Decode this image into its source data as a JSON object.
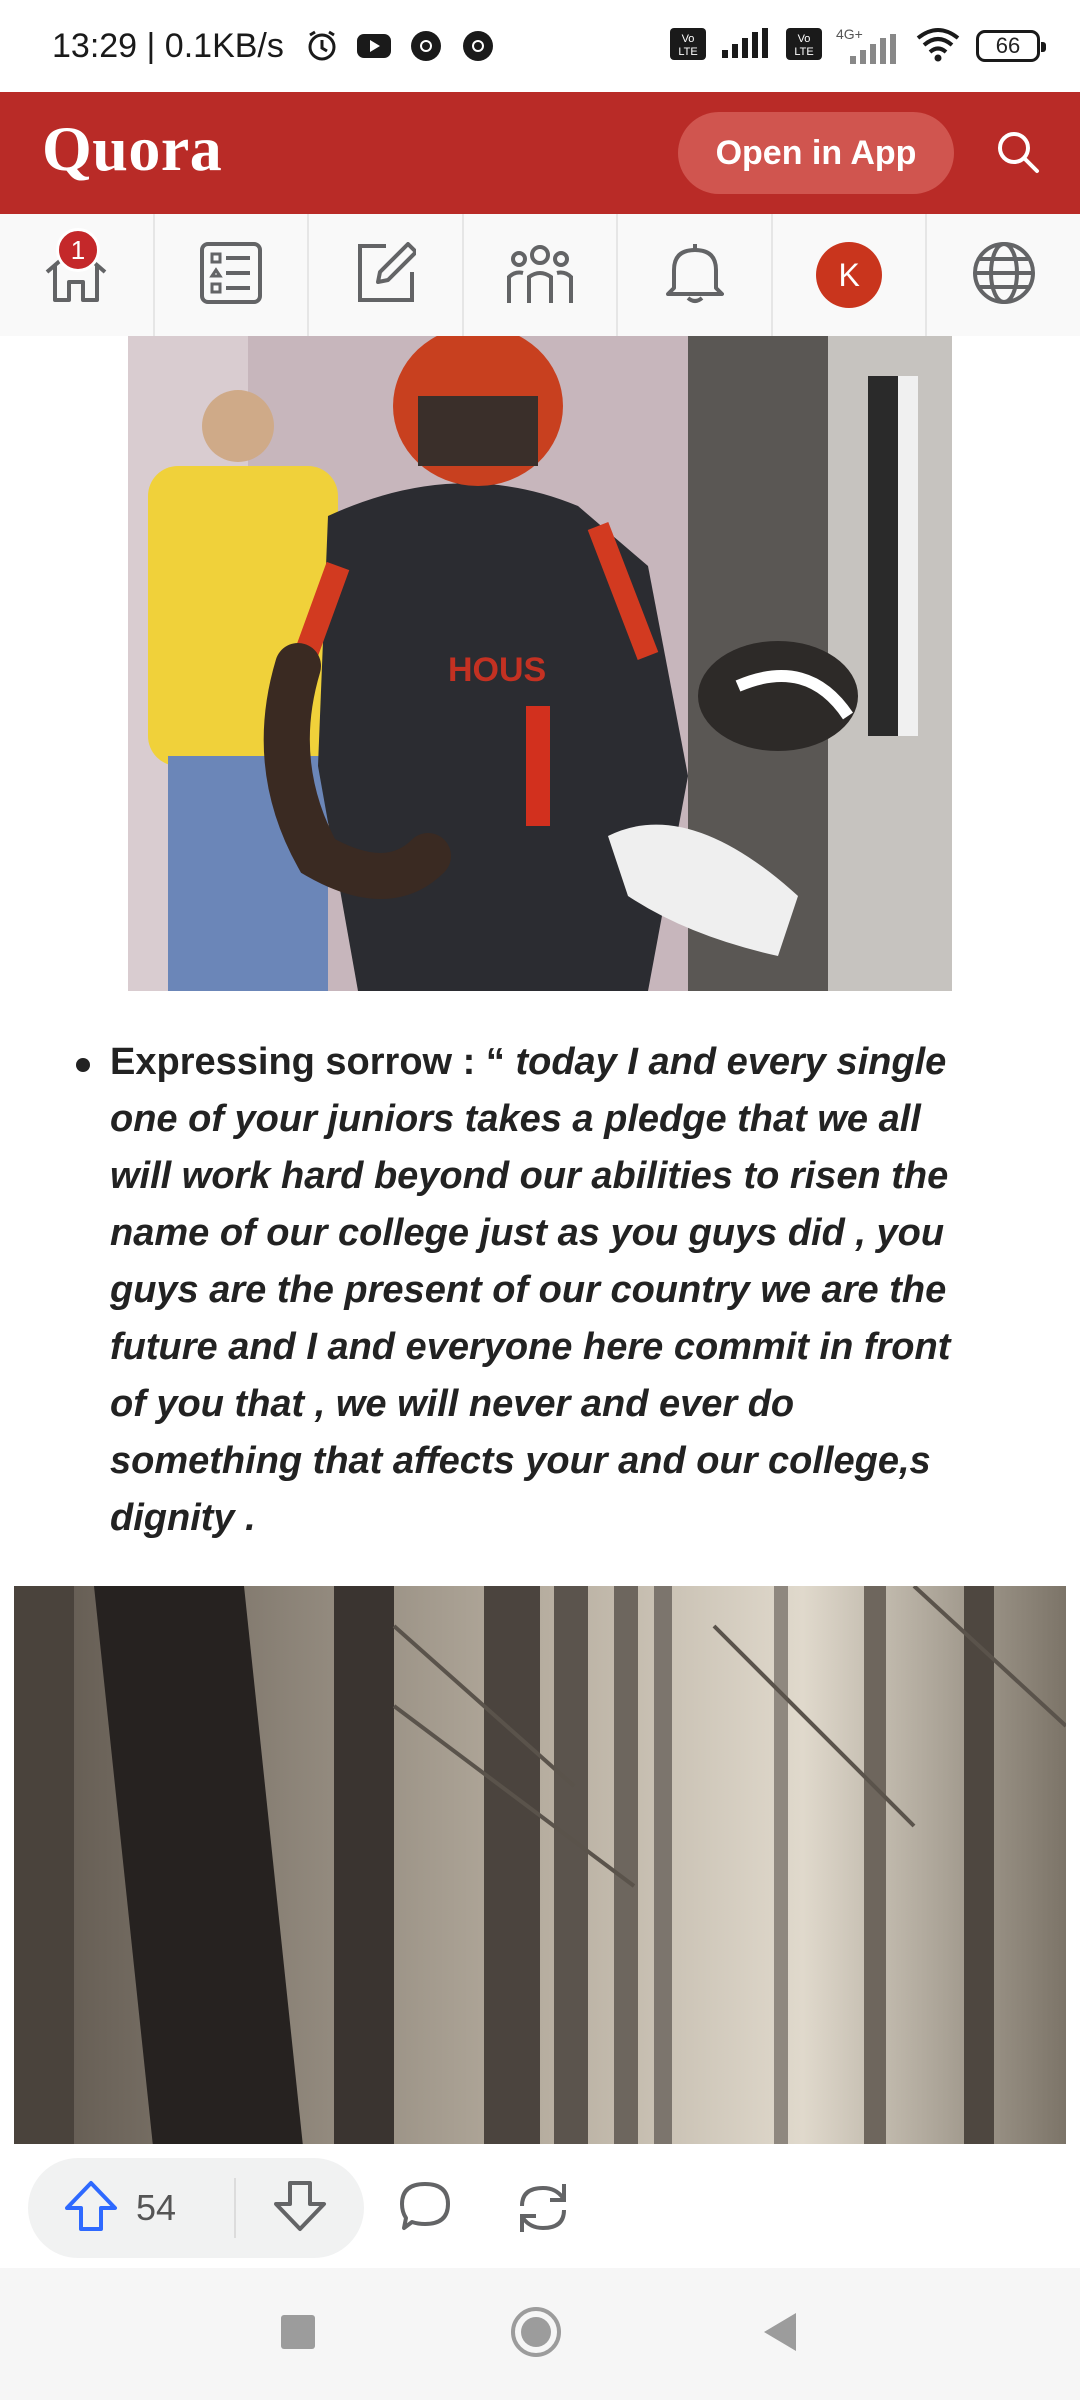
{
  "status_bar": {
    "time_speed": "13:29 | 0.1KB/s",
    "icons": [
      "alarm-icon",
      "youtube-icon",
      "chrome-icon",
      "chrome-icon"
    ],
    "volte1": "Vo LTE",
    "volte2": "Vo LTE",
    "network": "4G+",
    "battery": "66"
  },
  "header": {
    "logo": "Quora",
    "open_app_label": "Open in App",
    "brand_color": "#b92b27"
  },
  "nav": {
    "home_badge": "1",
    "avatar_initial": "K",
    "items": [
      "home-icon",
      "answer-list-icon",
      "write-icon",
      "spaces-icon",
      "notifications-icon",
      "profile-avatar",
      "language-globe-icon"
    ]
  },
  "post": {
    "bullet_label": "Expressing sorrow : “",
    "bullet_quote": " today I and every single one of your juniors takes a pledge that we all will work hard beyond our abilities to risen the name of our college just as you guys did , you guys are the present of our country we are the future and I and everyone here commit in front of you that , we will never and ever do something that affects your and our college,s dignity ."
  },
  "actions": {
    "upvote_count": "54"
  }
}
